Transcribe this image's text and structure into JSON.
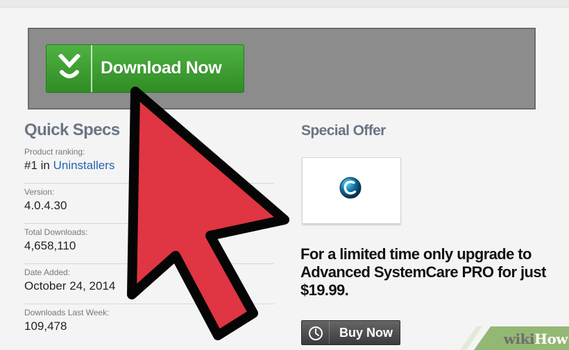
{
  "download": {
    "label": "Download Now",
    "icon": "download-chevron-icon",
    "accent_color": "#3c9c32"
  },
  "quick_specs": {
    "title": "Quick Specs",
    "items": [
      {
        "label": "Product ranking:",
        "value_prefix": "#1 in ",
        "link_text": "Uninstallers"
      },
      {
        "label": "Version:",
        "value": "4.0.4.30"
      },
      {
        "label": "Total Downloads:",
        "value": "4,658,110"
      },
      {
        "label": "Date Added:",
        "value": "October 24, 2014"
      },
      {
        "label": "Downloads Last Week:",
        "value": "109,478"
      }
    ]
  },
  "special_offer": {
    "title": "Special Offer",
    "logo": "advanced-systemcare-logo-icon",
    "text": "For a limited time only upgrade to Advanced SystemCare PRO for just $19.99.",
    "buy_label": "Buy Now",
    "buy_icon": "clock-icon"
  },
  "watermark": {
    "wiki": "wiki",
    "how": "How",
    "brand_color": "#93b874"
  },
  "cursor": {
    "icon": "red-arrow-cursor-icon",
    "color": "#e03542"
  }
}
